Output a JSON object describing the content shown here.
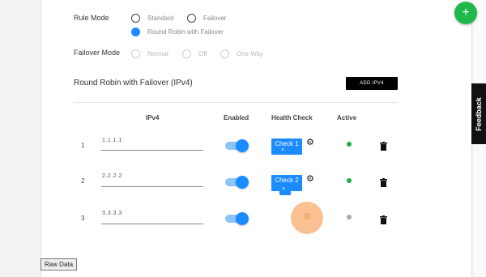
{
  "rule_mode": {
    "label": "Rule Mode",
    "options": [
      {
        "label": "Standard",
        "selected": false
      },
      {
        "label": "Failover",
        "selected": false
      },
      {
        "label": "Round Robin with Failover",
        "selected": true
      }
    ]
  },
  "failover_mode": {
    "label": "Failover Mode",
    "options": [
      {
        "label": "Normal",
        "disabled": true
      },
      {
        "label": "Off",
        "disabled": true
      },
      {
        "label": "One Way",
        "disabled": true
      }
    ]
  },
  "section": {
    "title": "Round Robin with Failover (IPv4)",
    "add_button": "ADD IPV4"
  },
  "table": {
    "headers": [
      "IPv4",
      "Enabled",
      "Health Check",
      "Active"
    ],
    "rows": [
      {
        "num": "1",
        "ip": "1.1.1.1",
        "enabled": true,
        "check_label": "Check 1",
        "check_remove": "×",
        "active": true,
        "active_color": "#22aa44"
      },
      {
        "num": "2",
        "ip": "2.2.2.2",
        "enabled": true,
        "check_label": "Check 2",
        "check_remove": "×",
        "active": true,
        "active_color": "#22aa44"
      },
      {
        "num": "3",
        "ip": "3.3.3.3",
        "enabled": true,
        "check_label": "",
        "check_remove": "",
        "active": false,
        "active_color": "#aaaaaa"
      }
    ]
  },
  "raw_data_button": "Raw Data",
  "fab_label": "+",
  "feedback_label": "Feedback",
  "icons": {
    "gear": "⚙",
    "fab": "plus-icon",
    "trash": "trash-icon"
  },
  "colors": {
    "accent": "#1a8cff",
    "fab": "#1fb84a",
    "highlight": "#f9b77e"
  }
}
